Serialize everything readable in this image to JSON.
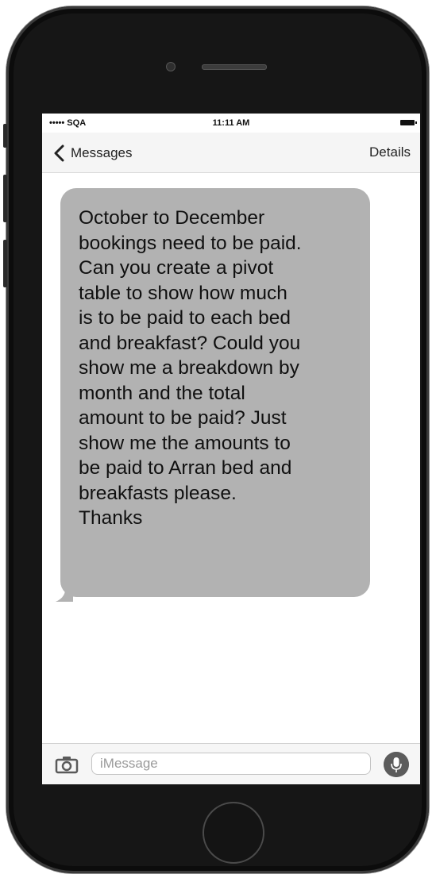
{
  "status_bar": {
    "carrier": "••••• SQA",
    "time": "11:11 AM"
  },
  "nav": {
    "back_label": "Messages",
    "details_label": "Details"
  },
  "message": {
    "text": "October to December\nbookings need to be paid.\nCan you create a pivot\ntable to show how much\nis to be paid to each bed\nand breakfast? Could you\nshow me a breakdown by\nmonth and the total\namount to be paid? Just\nshow me the amounts to\nbe paid to Arran bed and\nbreakfasts please.\nThanks"
  },
  "input": {
    "placeholder": "iMessage",
    "value": ""
  },
  "icons": {
    "back": "chevron-left-icon",
    "camera": "camera-icon",
    "mic": "microphone-icon",
    "battery": "battery-icon"
  },
  "colors": {
    "bubble": "#b2b2b2",
    "phone_body": "#161616",
    "nav_bar": "#f5f5f5"
  }
}
